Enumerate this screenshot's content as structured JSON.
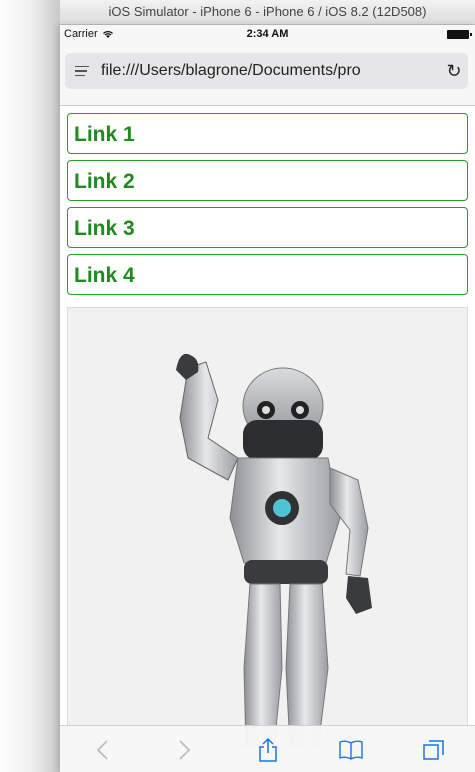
{
  "window": {
    "title": "iOS Simulator - iPhone 6 - iPhone 6 / iOS 8.2 (12D508)"
  },
  "status_bar": {
    "carrier": "Carrier",
    "time": "2:34 AM"
  },
  "url_bar": {
    "url": "file:///Users/blagrone/Documents/pro"
  },
  "links": [
    {
      "label": "Link 1"
    },
    {
      "label": "Link 2"
    },
    {
      "label": "Link 3"
    },
    {
      "label": "Link 4"
    }
  ],
  "colors": {
    "link_border": "#2a9a2a",
    "link_text": "#1f8a1f",
    "tint": "#1a73e8"
  },
  "toolbar": {
    "icons": [
      "back-icon",
      "forward-icon",
      "share-icon",
      "bookmarks-icon",
      "tabs-icon"
    ]
  }
}
